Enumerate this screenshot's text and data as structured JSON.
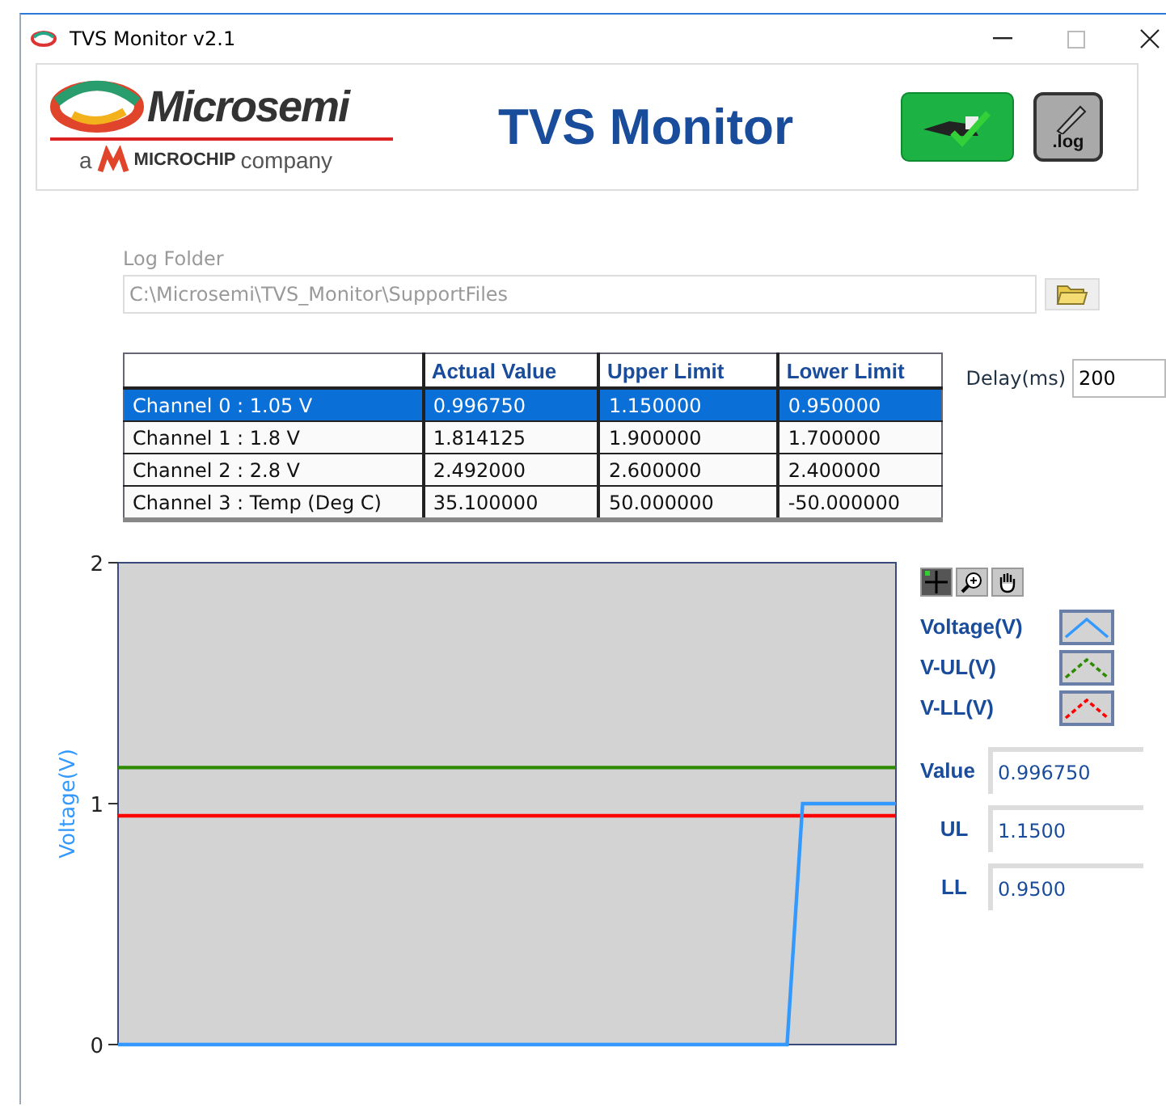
{
  "window": {
    "title": "TVS Monitor v2.1"
  },
  "header": {
    "brand": "Microsemi",
    "tagline_prefix": "a",
    "tagline_brand": "MICROCHIP",
    "tagline_suffix": "company",
    "title": "TVS Monitor",
    "log_button": ".log"
  },
  "log_folder": {
    "label": "Log Folder",
    "value": "C:\\Microsemi\\TVS_Monitor\\SupportFiles",
    "disabled": true
  },
  "table": {
    "columns": [
      "",
      "Actual Value",
      "Upper Limit",
      "Lower Limit"
    ],
    "rows": [
      {
        "cells": [
          "Channel 0 : 1.05 V",
          "0.996750",
          "1.150000",
          "0.950000"
        ],
        "selected": true
      },
      {
        "cells": [
          "Channel 1 : 1.8 V",
          "1.814125",
          "1.900000",
          "1.700000"
        ],
        "selected": false
      },
      {
        "cells": [
          "Channel 2 : 2.8 V",
          "2.492000",
          "2.600000",
          "2.400000"
        ],
        "selected": false
      },
      {
        "cells": [
          "Channel 3 : Temp (Deg C)",
          "35.100000",
          "50.000000",
          "-50.000000"
        ],
        "selected": false
      }
    ]
  },
  "delay": {
    "label": "Delay(ms)",
    "value": "200"
  },
  "chart": {
    "chart_data": {
      "type": "line",
      "ylabel": "Voltage(V)",
      "ylim": [
        0,
        2
      ],
      "yticks": [
        0,
        1,
        2
      ],
      "categories": [
        null,
        null,
        null,
        null,
        null,
        null,
        null,
        null,
        null,
        null,
        null,
        null,
        null,
        null,
        null,
        null,
        null,
        null,
        null,
        null,
        null,
        null,
        null,
        null,
        null,
        null,
        null,
        null,
        null,
        null,
        null,
        null,
        null,
        null,
        null,
        null,
        null,
        null,
        null,
        null,
        null,
        null,
        null,
        null,
        null,
        null,
        null,
        null,
        null,
        null,
        null
      ],
      "series": [
        {
          "name": "Voltage(V)",
          "color": "#3399ff",
          "values": [
            0,
            0,
            0,
            0,
            0,
            0,
            0,
            0,
            0,
            0,
            0,
            0,
            0,
            0,
            0,
            0,
            0,
            0,
            0,
            0,
            0,
            0,
            0,
            0,
            0,
            0,
            0,
            0,
            0,
            0,
            0,
            0,
            0,
            0,
            0,
            0,
            0,
            0,
            0,
            0,
            0,
            0,
            0,
            0,
            1,
            1,
            1,
            1,
            1,
            1,
            1
          ]
        },
        {
          "name": "V-UL(V)",
          "color": "#2e8b00",
          "values": [
            1.15,
            1.15,
            1.15,
            1.15,
            1.15,
            1.15,
            1.15,
            1.15,
            1.15,
            1.15,
            1.15,
            1.15,
            1.15,
            1.15,
            1.15,
            1.15,
            1.15,
            1.15,
            1.15,
            1.15,
            1.15,
            1.15,
            1.15,
            1.15,
            1.15,
            1.15,
            1.15,
            1.15,
            1.15,
            1.15,
            1.15,
            1.15,
            1.15,
            1.15,
            1.15,
            1.15,
            1.15,
            1.15,
            1.15,
            1.15,
            1.15,
            1.15,
            1.15,
            1.15,
            1.15,
            1.15,
            1.15,
            1.15,
            1.15,
            1.15,
            1.15
          ]
        },
        {
          "name": "V-LL(V)",
          "color": "#ff0000",
          "values": [
            0.95,
            0.95,
            0.95,
            0.95,
            0.95,
            0.95,
            0.95,
            0.95,
            0.95,
            0.95,
            0.95,
            0.95,
            0.95,
            0.95,
            0.95,
            0.95,
            0.95,
            0.95,
            0.95,
            0.95,
            0.95,
            0.95,
            0.95,
            0.95,
            0.95,
            0.95,
            0.95,
            0.95,
            0.95,
            0.95,
            0.95,
            0.95,
            0.95,
            0.95,
            0.95,
            0.95,
            0.95,
            0.95,
            0.95,
            0.95,
            0.95,
            0.95,
            0.95,
            0.95,
            0.95,
            0.95,
            0.95,
            0.95,
            0.95,
            0.95,
            0.95
          ]
        }
      ]
    }
  },
  "legend": [
    {
      "kind": "solid"
    },
    {
      "kind": "dashed"
    },
    {
      "kind": "dashed"
    }
  ],
  "readouts": [
    {
      "label": "Value",
      "value": "0.996750"
    },
    {
      "label": "UL",
      "value": "1.1500"
    },
    {
      "label": "LL",
      "value": "0.9500"
    }
  ]
}
